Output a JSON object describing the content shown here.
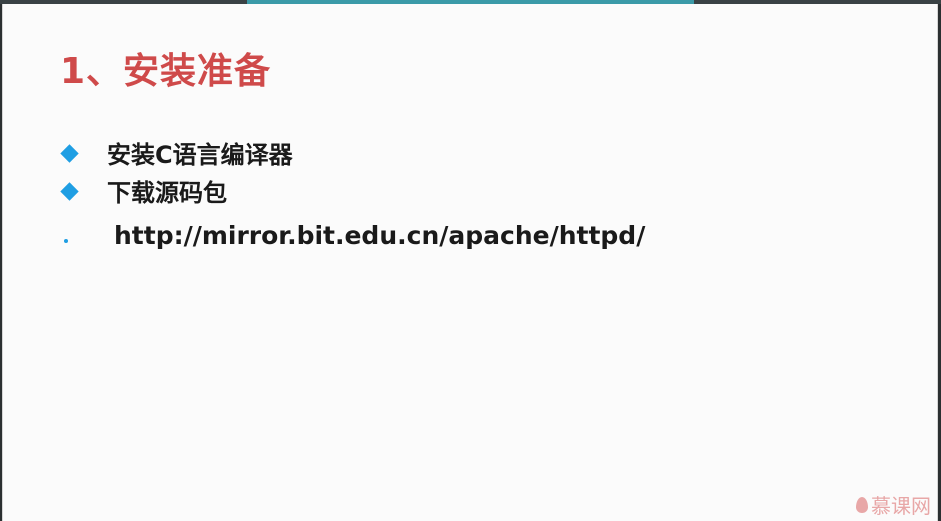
{
  "slide": {
    "title": "1、安装准备",
    "items": [
      {
        "text": "安装C语言编译器",
        "bullet": "diamond"
      },
      {
        "text": "下载源码包",
        "bullet": "diamond"
      },
      {
        "text": "http://mirror.bit.edu.cn/apache/httpd/",
        "bullet": "dot"
      }
    ]
  },
  "watermark": {
    "text": "慕课网"
  },
  "player": {
    "progress_percent": 47.5
  },
  "colors": {
    "title": "#cf4a4a",
    "bullet": "#1f9ee3",
    "progress": "#3b9aa8"
  }
}
